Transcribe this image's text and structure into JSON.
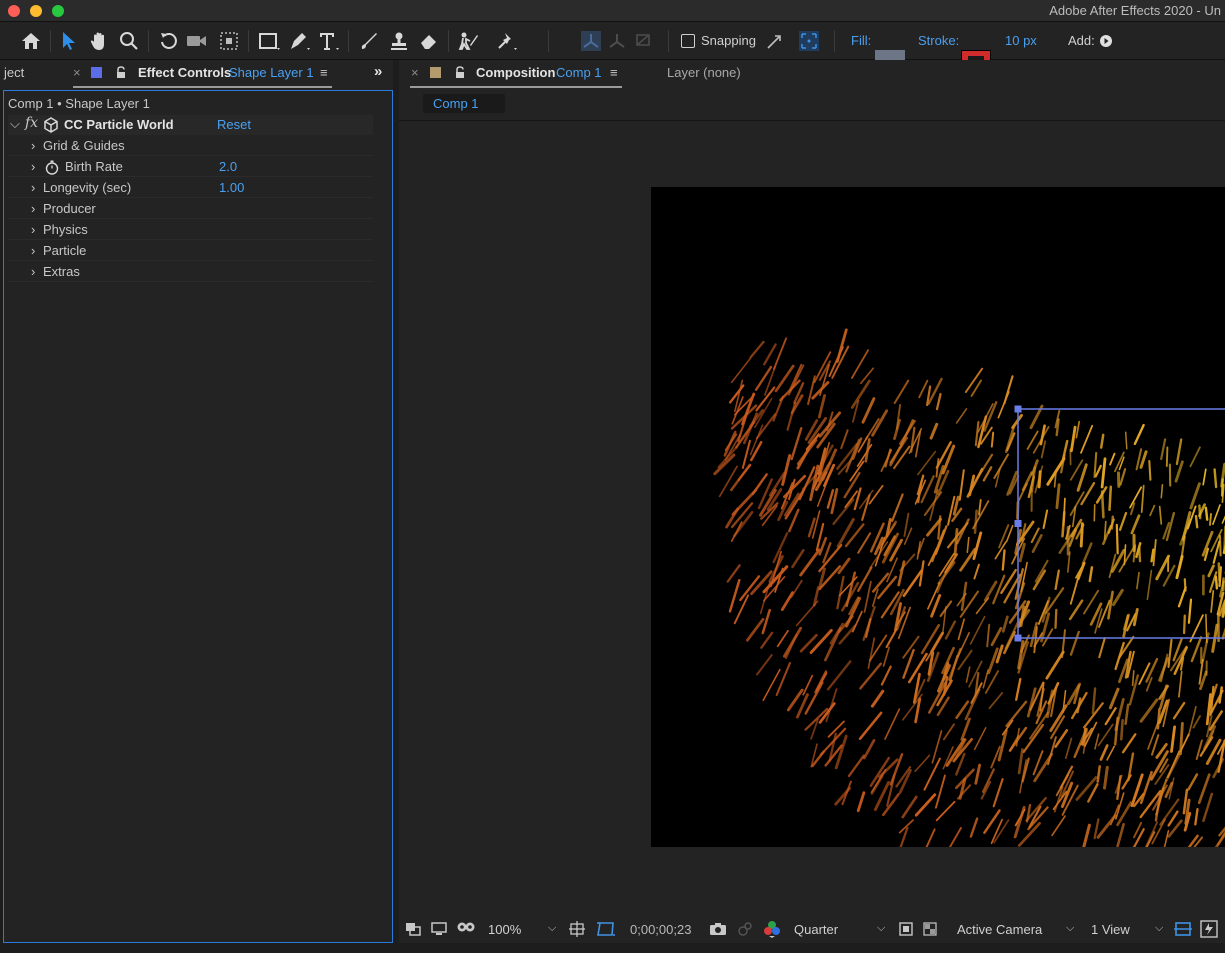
{
  "titlebar": {
    "app_title": "Adobe After Effects 2020 - Un",
    "traffic_colors": [
      "#fd5f57",
      "#febc2e",
      "#28c840"
    ]
  },
  "toolbar": {
    "snapping_label": "Snapping",
    "fill_label": "Fill:",
    "fill_color": "#6d7686",
    "stroke_label": "Stroke:",
    "stroke_color": "#d02b2b",
    "stroke_width": "10 px",
    "add_label": "Add:",
    "icons": [
      "home-icon",
      "selection-tool-icon",
      "hand-tool-icon",
      "zoom-tool-icon",
      "rotate-tool-icon",
      "camera-tool-icon",
      "pan-behind-tool-icon",
      "rectangle-tool-icon",
      "pen-tool-icon",
      "type-tool-icon",
      "brush-tool-icon",
      "clone-stamp-icon",
      "eraser-icon",
      "roto-brush-icon",
      "puppet-pin-icon"
    ]
  },
  "left_panel": {
    "project_tab_fragment": "ject",
    "close_symbol": "×",
    "tab_color": "#5b6ee8",
    "tab_title": "Effect Controls",
    "tab_layer": "Shape Layer 1",
    "menu_symbol": "≡",
    "overflow_symbol": "»",
    "breadcrumb": "Comp 1 • Shape Layer 1",
    "effect": {
      "name": "CC Particle World",
      "reset_label": "Reset",
      "fx_label": "fx",
      "properties": [
        {
          "label": "Grid & Guides",
          "value": "",
          "stopwatch": false
        },
        {
          "label": "Birth Rate",
          "value": "2.0",
          "stopwatch": true
        },
        {
          "label": "Longevity (sec)",
          "value": "1.00",
          "stopwatch": false
        },
        {
          "label": "Producer",
          "value": "",
          "stopwatch": false
        },
        {
          "label": "Physics",
          "value": "",
          "stopwatch": false
        },
        {
          "label": "Particle",
          "value": "",
          "stopwatch": false
        },
        {
          "label": "Extras",
          "value": "",
          "stopwatch": false
        }
      ]
    }
  },
  "comp_panel": {
    "close_symbol": "×",
    "tab_color": "#b39b6e",
    "tab_title": "Composition",
    "tab_comp": "Comp 1",
    "menu_symbol": "≡",
    "layer_tab": "Layer (none)",
    "sub_tab": "Comp 1"
  },
  "viewer_bar": {
    "zoom": "100%",
    "timecode": "0;00;00;23",
    "resolution": "Quarter",
    "camera": "Active Camera",
    "views": "1 View",
    "dropdown_symbol": "⌵"
  }
}
